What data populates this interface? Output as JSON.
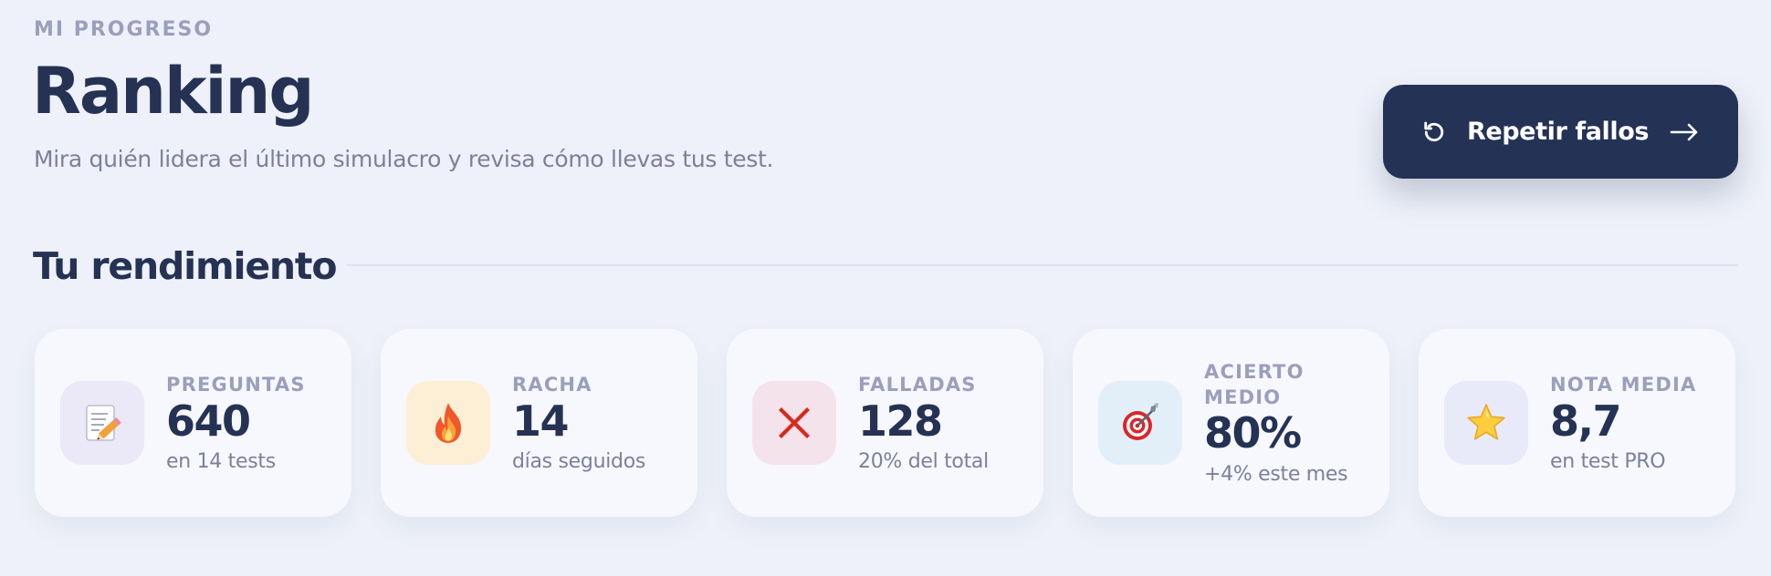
{
  "header": {
    "eyebrow": "MI PROGRESO",
    "title": "Ranking",
    "subtitle": "Mira quién lidera el último simulacro y revisa cómo llevas tus test.",
    "cta_label": "Repetir fallos"
  },
  "section": {
    "title": "Tu rendimiento"
  },
  "colors": {
    "background": "#eef1f9",
    "primary": "#243256",
    "muted": "#9aa0bb"
  },
  "stats": [
    {
      "icon": "notepad-pencil-icon",
      "tile_color": "#ebe8f8",
      "label": "PREGUNTAS",
      "value": "640",
      "sub": "en 14 tests"
    },
    {
      "icon": "fire-icon",
      "tile_color": "#fcefd5",
      "label": "RACHA",
      "value": "14",
      "sub": "días seguidos"
    },
    {
      "icon": "cross-mark-icon",
      "tile_color": "#f5e3ec",
      "label": "FALLADAS",
      "value": "128",
      "sub": "20% del total"
    },
    {
      "icon": "target-dart-icon",
      "tile_color": "#e3eff8",
      "label": "ACIERTO MEDIO",
      "value": "80%",
      "sub": "+4% este mes"
    },
    {
      "icon": "star-icon",
      "tile_color": "#e8eaf9",
      "label": "NOTA MEDIA",
      "value": "8,7",
      "sub": "en test PRO"
    }
  ]
}
